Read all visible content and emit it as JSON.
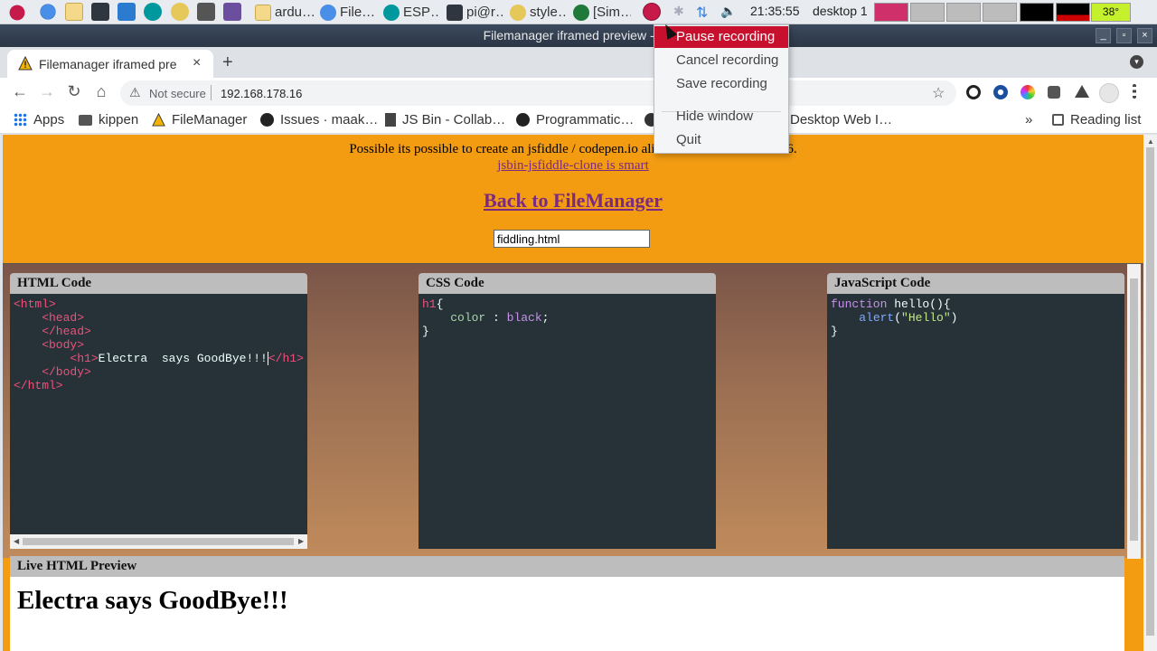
{
  "taskbar": {
    "apps": [
      {
        "label": "ardu…",
        "icon": "folder-icon"
      },
      {
        "label": "File…",
        "icon": "chromium-icon"
      },
      {
        "label": "ESP…",
        "icon": "arduino-icon"
      },
      {
        "label": "pi@r…",
        "icon": "terminal-icon"
      },
      {
        "label": "style…",
        "icon": "gimp-icon"
      },
      {
        "label": "[Sim…",
        "icon": "simplescreenrecorder-icon"
      }
    ],
    "clock": "21:35:55",
    "desktop": "desktop 1",
    "temperature": "38°"
  },
  "window": {
    "title": "Filemanager iframed preview - Ch"
  },
  "tab": {
    "title": "Filemanager iframed pre",
    "close": "×",
    "new_tab": "+"
  },
  "omnibox": {
    "security": "Not secure",
    "url": "192.168.178.16"
  },
  "bookmarks": [
    {
      "label": "Apps",
      "icon": "apps-grid-icon"
    },
    {
      "label": "kippen",
      "icon": "folder-icon"
    },
    {
      "label": "FileManager",
      "icon": "warning-icon"
    },
    {
      "label": "Issues · maak…",
      "icon": "github-icon"
    },
    {
      "label": "JS Bin - Collab…",
      "icon": "jsbin-icon"
    },
    {
      "label": "Programmatic…",
      "icon": "github-icon"
    },
    {
      "label": "Desktop Web I…",
      "icon": "globe-icon"
    }
  ],
  "bookmarks_more": "»",
  "reading_list": "Reading list",
  "page": {
    "intro": "Possible its possible to create an jsfiddle / codepen.io alike editor on the ESP8266.",
    "clone_link": "jsbin-jsfiddle-clone is smart",
    "back_link": "Back to FileManager",
    "filename": "fiddling.html",
    "panels": {
      "html": "HTML Code",
      "css": "CSS Code",
      "js": "JavaScript Code"
    },
    "preview_title": "Live HTML Preview",
    "preview_h1": "Electra says GoodBye!!!"
  },
  "code": {
    "html": [
      "<html>",
      "    <head>",
      "    </head>",
      "    <body>",
      "        <h1>",
      "Electra  says GoodBye!!!",
      "</h1>",
      "    </body>",
      "</html>"
    ],
    "css": [
      "h1",
      "{",
      "color",
      " : ",
      "black",
      ";",
      "}"
    ],
    "js": [
      "function",
      " hello(){",
      "alert",
      "(",
      "\"Hello\"",
      ")",
      "}"
    ]
  },
  "popup_menu": {
    "items": [
      "Pause recording",
      "Cancel recording",
      "Save recording",
      "Hide window",
      "Quit"
    ],
    "active": "Pause recording"
  },
  "colors": {
    "page_bg": "#f39c12",
    "menu_active": "#c8102e",
    "code_bg": "#263238",
    "tag": "#f0507a",
    "link": "#7a2a80"
  }
}
